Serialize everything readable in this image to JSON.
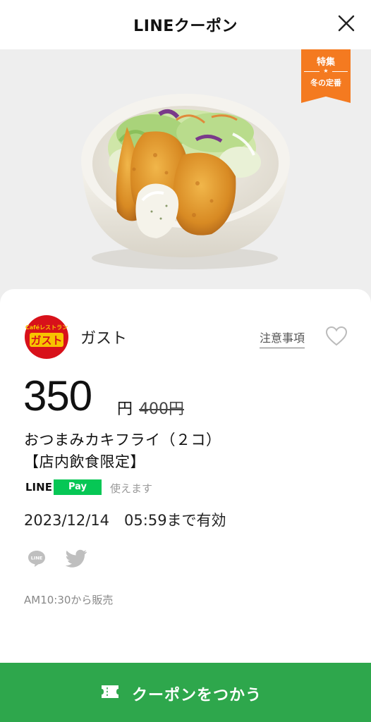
{
  "header": {
    "title": "LINEクーポン",
    "close_icon": "close-icon"
  },
  "badge": {
    "top": "特集",
    "star": "★",
    "bottom": "冬の定番",
    "color": "#f47a20"
  },
  "brand": {
    "name": "ガスト",
    "logo_top": "Caféレストラン",
    "logo_main": "ガスト",
    "logo_color": "#d8111a"
  },
  "notes_link": "注意事項",
  "price": {
    "value": "350",
    "unit": "円",
    "original": "400円"
  },
  "item": {
    "title_line1": "おつまみカキフライ（２コ）",
    "title_line2": "【店内飲食限定】"
  },
  "linepay": {
    "line": "LINE",
    "pay": "Pay",
    "text": "使えます",
    "color": "#06c755"
  },
  "validity": "2023/12/14　05:59まで有効",
  "share": {
    "line_label": "LINE",
    "twitter_icon": "twitter-icon"
  },
  "sale_note": "AM10:30から販売",
  "cta": {
    "label": "クーポンをつかう",
    "icon": "ticket-icon",
    "color": "#2ea74c"
  }
}
